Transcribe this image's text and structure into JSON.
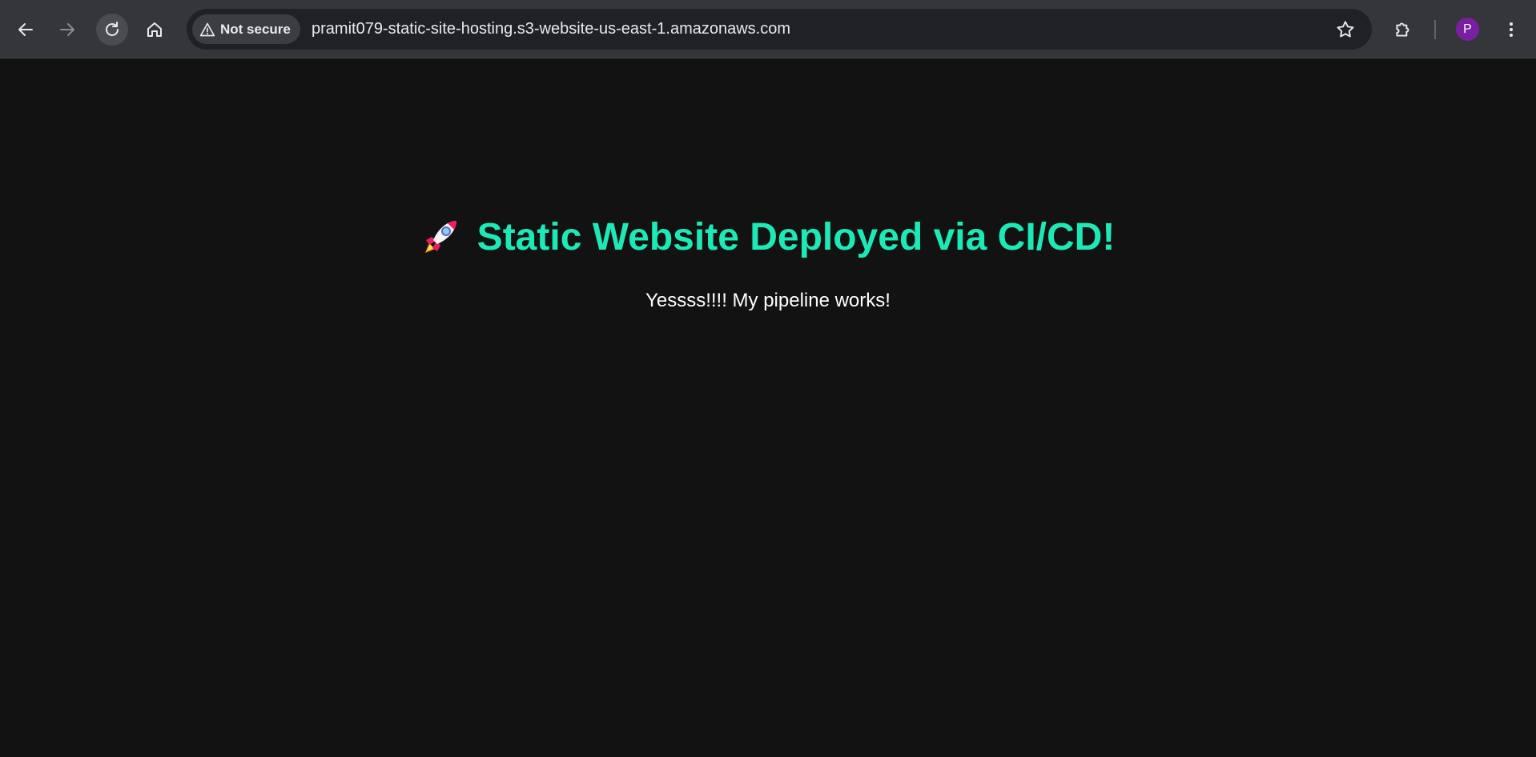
{
  "browser": {
    "security_label": "Not secure",
    "url": "pramit079-static-site-hosting.s3-website-us-east-1.amazonaws.com",
    "profile_initial": "P",
    "icons": {
      "back": "arrow-left-icon",
      "forward": "arrow-right-icon",
      "reload": "reload-icon",
      "home": "home-icon",
      "warning": "warning-triangle-icon",
      "bookmark": "star-icon",
      "extensions": "puzzle-icon",
      "menu": "kebab-menu-icon"
    },
    "colors": {
      "toolbar": "#35363a",
      "omnibox": "#202124",
      "avatar": "#7b1fa2"
    }
  },
  "page": {
    "heading": "Static Website Deployed via CI/CD!",
    "heading_emoji": "rocket-icon",
    "message": "Yessss!!!! My pipeline works!",
    "colors": {
      "background": "#121212",
      "heading": "#1de9b6",
      "message": "#ffffff"
    }
  }
}
